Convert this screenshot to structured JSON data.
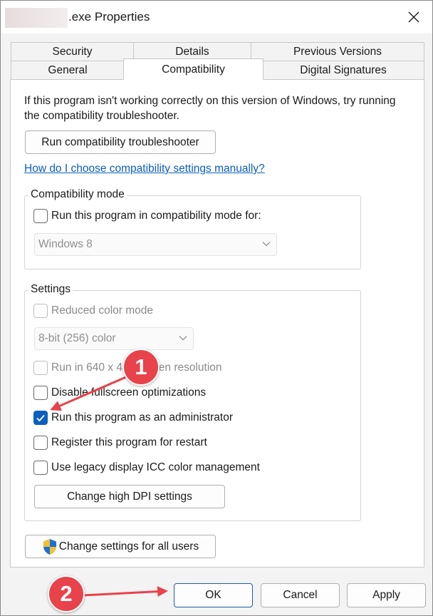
{
  "window": {
    "title": ".exe Properties"
  },
  "tabs": {
    "row1": [
      "Security",
      "Details",
      "Previous Versions"
    ],
    "row2": [
      "General",
      "Compatibility",
      "Digital Signatures"
    ],
    "active": "Compatibility"
  },
  "intro": {
    "text": "If this program isn't working correctly on this version of Windows, try running the compatibility troubleshooter."
  },
  "troubleshooter": {
    "button_label": "Run compatibility troubleshooter",
    "help_link": "How do I choose compatibility settings manually?"
  },
  "compat_mode": {
    "group_label": "Compatibility mode",
    "checkbox_label": "Run this program in compatibility mode for:",
    "checked": false,
    "select_value": "Windows 8"
  },
  "settings": {
    "group_label": "Settings",
    "reduced_color": {
      "label": "Reduced color mode",
      "checked": false,
      "enabled": false
    },
    "color_select_value": "8-bit (256) color",
    "res_640": {
      "label": "Run in 640 x 480 screen resolution",
      "checked": false,
      "enabled": false
    },
    "fullscreen_opt": {
      "label": "Disable fullscreen optimizations",
      "checked": false,
      "enabled": true
    },
    "run_as_admin": {
      "label": "Run this program as an administrator",
      "checked": true,
      "enabled": true
    },
    "register_restart": {
      "label": "Register this program for restart",
      "checked": false,
      "enabled": true
    },
    "legacy_icc": {
      "label": "Use legacy display ICC color management",
      "checked": false,
      "enabled": true
    },
    "dpi_button_label": "Change high DPI settings"
  },
  "all_users_button_label": "Change settings for all users",
  "footer": {
    "ok_label": "OK",
    "cancel_label": "Cancel",
    "apply_label": "Apply"
  },
  "callouts": {
    "first": "1",
    "second": "2",
    "color": "#e8424a"
  },
  "colors": {
    "accent": "#0a5fbf",
    "primary_button_border": "#1b5fad",
    "dialog_bg": "#f3f3f3",
    "panel_bg": "#ffffff"
  }
}
